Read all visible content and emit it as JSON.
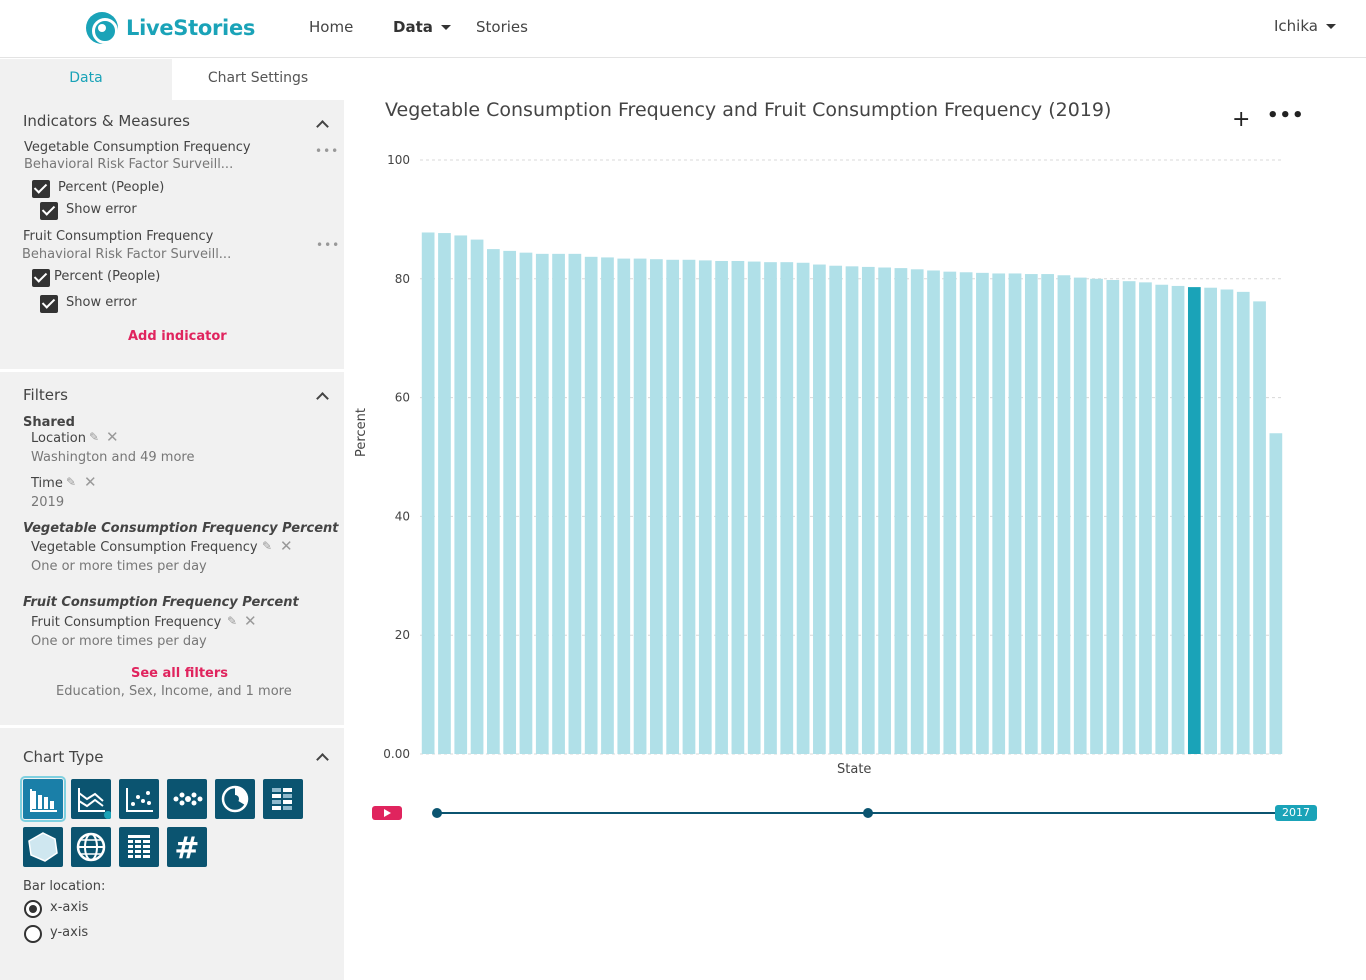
{
  "app": {
    "name": "LiveStories",
    "brand_color": "#1aa3b8",
    "accent_color": "#e0245e"
  },
  "nav": {
    "home": "Home",
    "data": "Data",
    "stories": "Stories",
    "user": "Ichika"
  },
  "sidebar": {
    "tabs": [
      "Data",
      "Chart Settings"
    ],
    "indicators": {
      "title": "Indicators & Measures",
      "items": [
        {
          "name": "Vegetable Consumption Frequency",
          "source": "Behavioral Risk Factor Surveill...",
          "measure": "Percent (People)",
          "show_error": "Show error"
        },
        {
          "name": "Fruit Consumption Frequency",
          "source": "Behavioral Risk Factor Surveill...",
          "measure": "Percent (People)",
          "show_error": "Show error"
        }
      ],
      "add": "Add indicator"
    },
    "filters": {
      "title": "Filters",
      "shared_label": "Shared",
      "location_label": "Location",
      "location_value": "Washington and 49 more",
      "time_label": "Time",
      "time_value": "2019",
      "veg_group": "Vegetable Consumption Frequency Percent",
      "veg_filter": "Vegetable Consumption Frequency",
      "veg_value": "One or more times per day",
      "fruit_group": "Fruit Consumption Frequency Percent",
      "fruit_filter": "Fruit Consumption Frequency",
      "fruit_value": "One or more times per day",
      "see_all": "See all filters",
      "more": "Education, Sex, Income, and 1 more"
    },
    "chart_type": {
      "title": "Chart Type",
      "icons": [
        "bar-chart-icon",
        "line-chart-icon",
        "scatter-chart-icon",
        "bubble-chart-icon",
        "pie-chart-icon",
        "heatmap-icon",
        "radar-chart-icon",
        "map-globe-icon",
        "table-icon",
        "number-icon"
      ],
      "bar_location_label": "Bar location:",
      "options": [
        "x-axis",
        "y-axis"
      ],
      "selected": "x-axis"
    }
  },
  "main": {
    "title": "Vegetable Consumption Frequency and Fruit Consumption Frequency (2019)",
    "plus": "+",
    "more": "•••",
    "timeline": {
      "badge": "2017"
    }
  },
  "chart_data": {
    "type": "bar",
    "title": "Vegetable Consumption Frequency and Fruit Consumption Frequency (2019)",
    "xlabel": "State",
    "ylabel": "Percent",
    "ylim": [
      0,
      100
    ],
    "yticks": [
      "0.00",
      "20",
      "40",
      "60",
      "80",
      "100"
    ],
    "grid": true,
    "bar_color": "#b0e0e8",
    "highlight_color": "#1aa3b8",
    "highlight_index": 47,
    "values": [
      87.8,
      87.7,
      87.3,
      86.6,
      85.0,
      84.7,
      84.4,
      84.2,
      84.2,
      84.2,
      83.7,
      83.6,
      83.4,
      83.4,
      83.3,
      83.2,
      83.2,
      83.1,
      83.0,
      83.0,
      82.9,
      82.8,
      82.8,
      82.7,
      82.4,
      82.2,
      82.1,
      82.0,
      81.9,
      81.8,
      81.6,
      81.4,
      81.2,
      81.1,
      81.0,
      80.9,
      80.9,
      80.8,
      80.8,
      80.6,
      80.2,
      80.0,
      79.8,
      79.6,
      79.4,
      79.0,
      78.8,
      78.6,
      78.5,
      78.2,
      77.8,
      76.2,
      54.0
    ]
  }
}
